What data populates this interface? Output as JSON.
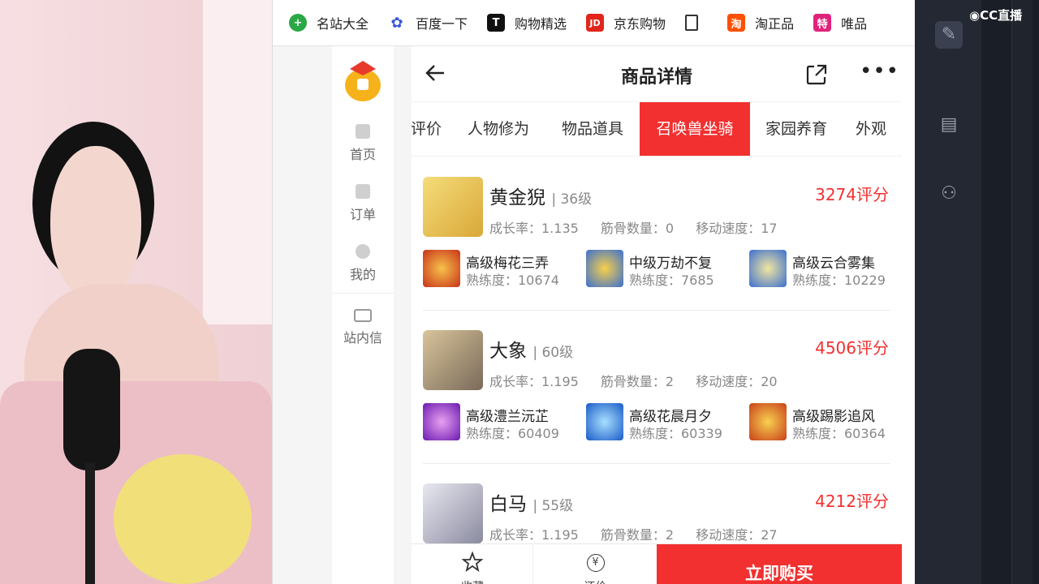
{
  "bookmarks": [
    {
      "label": "名站大全",
      "icon": "plus-circle-icon",
      "color": "#2aa845"
    },
    {
      "label": "百度一下",
      "icon": "baidu-paw-icon",
      "color": "#3a57d8"
    },
    {
      "label": "购物精选",
      "icon": "tmall-icon",
      "color": "#c8102e"
    },
    {
      "label": "京东购物",
      "icon": "jd-icon",
      "color": "#e1251b"
    },
    {
      "label": "",
      "icon": "document-icon",
      "color": "#444444"
    },
    {
      "label": "淘正品",
      "icon": "taobao-icon",
      "color": "#ff5000"
    },
    {
      "label": "唯品",
      "icon": "vip-icon",
      "color": "#e0237a"
    }
  ],
  "sidenav": {
    "items": [
      {
        "label": "首页",
        "icon": "home-icon"
      },
      {
        "label": "订单",
        "icon": "order-icon"
      },
      {
        "label": "我的",
        "icon": "user-icon"
      },
      {
        "label": "站内信",
        "icon": "mail-icon"
      }
    ]
  },
  "header": {
    "title": "商品详情"
  },
  "tabs": [
    {
      "label": "评价",
      "active": false
    },
    {
      "label": "人物修为",
      "active": false
    },
    {
      "label": "物品道具",
      "active": false
    },
    {
      "label": "召唤兽坐骑",
      "active": true
    },
    {
      "label": "家园养育",
      "active": false
    },
    {
      "label": "外观",
      "active": false
    }
  ],
  "pets": [
    {
      "name": "黄金猊",
      "level": "| 36级",
      "score": "3274评分",
      "growth": "成长率：1.135",
      "bones": "筋骨数量：0",
      "speed": "移动速度：17",
      "avatar_color": "#e8c14a",
      "skills": [
        {
          "name": "高级梅花三弄",
          "proficiency": "熟练度：10674",
          "color": "#d8451c"
        },
        {
          "name": "中级万劫不复",
          "proficiency": "熟练度：7685",
          "color": "#e09a1a"
        },
        {
          "name": "高级云合雾集",
          "proficiency": "熟练度：10229",
          "color": "#3a6fd0"
        }
      ]
    },
    {
      "name": "大象",
      "level": "| 60级",
      "score": "4506评分",
      "growth": "成长率：1.195",
      "bones": "筋骨数量：2",
      "speed": "移动速度：20",
      "avatar_color": "#8a7a6a",
      "skills": [
        {
          "name": "高级澧兰沅芷",
          "proficiency": "熟练度：60409",
          "color": "#9a3ac8"
        },
        {
          "name": "高级花晨月夕",
          "proficiency": "熟练度：60339",
          "color": "#2a7ad8"
        },
        {
          "name": "高级踢影追风",
          "proficiency": "熟练度：60364",
          "color": "#e0781a"
        }
      ]
    },
    {
      "name": "白马",
      "level": "| 55级",
      "score": "4212评分",
      "growth": "成长率：1.195",
      "bones": "筋骨数量：2",
      "speed": "移动速度：27",
      "avatar_color": "#b8b8c4",
      "skills": []
    }
  ],
  "bottom": {
    "favorite_label": "收藏",
    "price_label": "还价",
    "buy_label": "立即购买"
  },
  "overlay": {
    "logo_text": "CC直播"
  },
  "colors": {
    "accent": "#f23030",
    "right_panel": "#1a1e27"
  }
}
